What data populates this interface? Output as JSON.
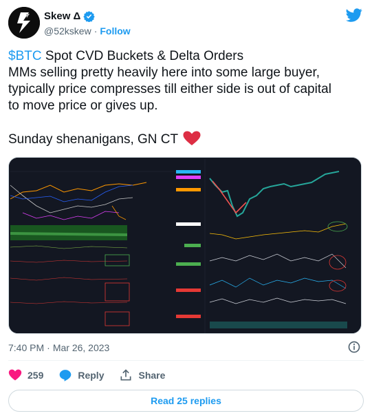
{
  "author": {
    "display_name": "Skew Δ",
    "handle": "@52kskew",
    "separator": "·",
    "follow_label": "Follow",
    "verified_icon": "verified-badge-icon",
    "avatar_icon": "skew-logo-avatar"
  },
  "brand": {
    "icon": "twitter-bird-icon",
    "color": "#1d9bf0"
  },
  "tweet": {
    "cashtag": "$BTC",
    "line1_rest": " Spot CVD Buckets & Delta Orders",
    "line2": "MMs selling pretty heavily here into some large buyer,",
    "line3": "typically price compresses till either side is out of capital",
    "line4": "to move price or gives up.",
    "line6": "Sunday shenanigans, GN CT",
    "emoji": "red-heart-emoji"
  },
  "meta": {
    "time": "7:40 PM",
    "separator": "·",
    "date": "Mar 26, 2023",
    "info_icon": "info-icon"
  },
  "actions": {
    "like_count": "259",
    "reply_label": "Reply",
    "share_label": "Share"
  },
  "footer": {
    "read_replies_label": "Read 25 replies"
  },
  "colors": {
    "text": "#0f1419",
    "secondary": "#536471",
    "accent": "#1d9bf0",
    "like": "#f91880",
    "chart_bg": "#131722"
  }
}
